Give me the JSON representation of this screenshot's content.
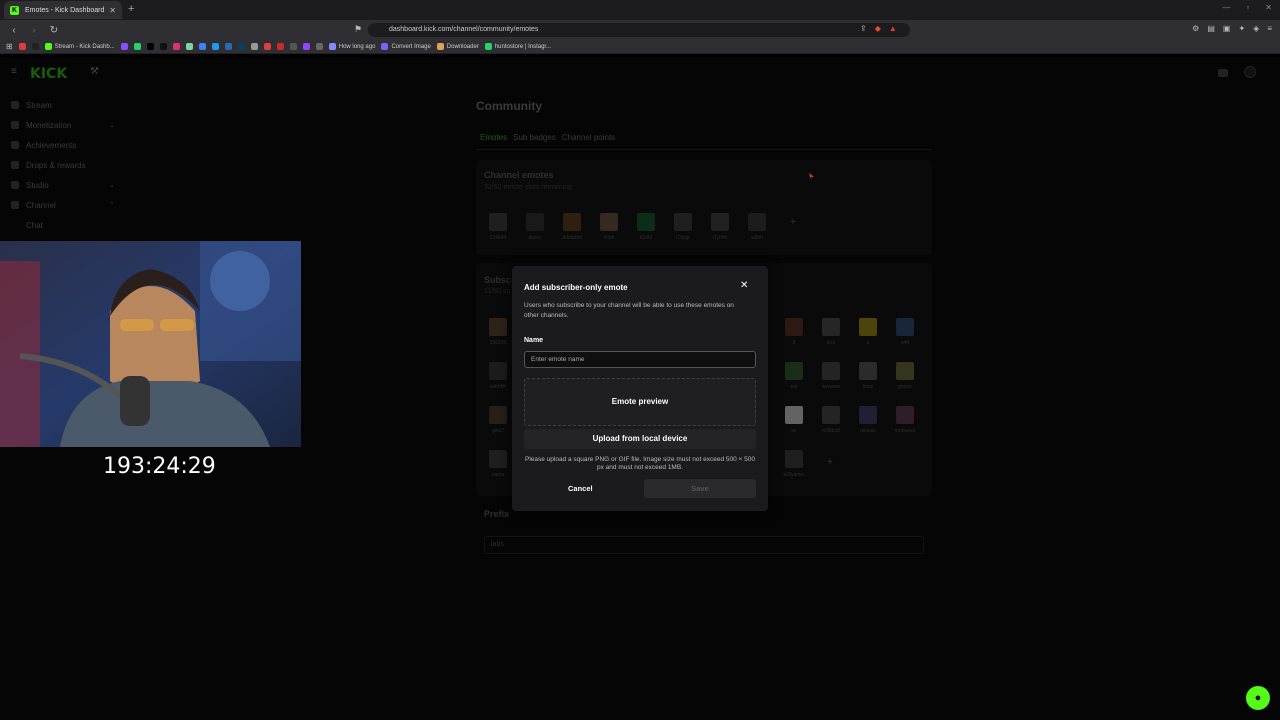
{
  "browser": {
    "tab_title": "Emotes - Kick Dashboard",
    "url": "dashboard.kick.com/channel/community/emotes",
    "bookmarks": [
      {
        "label": "",
        "color": "#e23c3c"
      },
      {
        "label": "",
        "color": "#222222"
      },
      {
        "label": "Stream - Kick Dashb...",
        "color": "#53fc18"
      },
      {
        "label": "",
        "color": "#8a4fff"
      },
      {
        "label": "",
        "color": "#25d366"
      },
      {
        "label": "",
        "color": "#000000"
      },
      {
        "label": "",
        "color": "#111111"
      },
      {
        "label": "",
        "color": "#e1306c"
      },
      {
        "label": "",
        "color": "#7fd4a6"
      },
      {
        "label": "",
        "color": "#3b82f6"
      },
      {
        "label": "",
        "color": "#1d9bf0"
      },
      {
        "label": "",
        "color": "#2b6cb0"
      },
      {
        "label": "",
        "color": "#0a3d62"
      },
      {
        "label": "",
        "color": "#999999"
      },
      {
        "label": "",
        "color": "#e23c3c"
      },
      {
        "label": "",
        "color": "#cc2929"
      },
      {
        "label": "",
        "color": "#555555"
      },
      {
        "label": "",
        "color": "#9146ff"
      },
      {
        "label": "",
        "color": "#666666"
      },
      {
        "label": "How long ago",
        "color": "#8888ff"
      },
      {
        "label": "Convert Image",
        "color": "#7b61ff"
      },
      {
        "label": "Downloader",
        "color": "#e0a05a"
      },
      {
        "label": "huntostore | Instagr...",
        "color": "#25d366"
      }
    ]
  },
  "sidebar": {
    "items": [
      {
        "label": "Stream"
      },
      {
        "label": "Monetization",
        "chevron": "⌄"
      },
      {
        "label": "Achievements"
      },
      {
        "label": "Drops & rewards"
      },
      {
        "label": "Studio",
        "chevron": "⌄"
      },
      {
        "label": "Channel",
        "chevron": "⌃"
      }
    ],
    "sub_item": "Chat"
  },
  "overlay": {
    "timer": "193:24:29"
  },
  "community": {
    "title": "Community",
    "tabs": [
      "Emotes",
      "Sub badges",
      "Channel points"
    ],
    "channel_emotes": {
      "title": "Channel emotes",
      "subtitle": "32/60 emote slots remaining",
      "emotes": [
        {
          "name": "224244",
          "color": "#3a3a3a"
        },
        {
          "name": "dance",
          "color": "#2c2c2c"
        },
        {
          "name": "ddddddd",
          "color": "#5a3a1a"
        },
        {
          "name": "hhhh",
          "color": "#6a5040"
        },
        {
          "name": "KSA1",
          "color": "#0f5a2a"
        },
        {
          "name": "t79pgr",
          "color": "#3a3a3a"
        },
        {
          "name": "i7yhhh",
          "color": "#3d3d3d"
        },
        {
          "name": "w8hh",
          "color": "#333333"
        }
      ]
    },
    "sub_emotes": {
      "title": "Subsc",
      "subtitle": "11/60 su",
      "left_emotes": [
        {
          "name": "236235",
          "color": "#5a4030"
        },
        {
          "name": "ashhhh",
          "color": "#333333"
        },
        {
          "name": "gisa7",
          "color": "#4a3a2a"
        },
        {
          "name": "nasra",
          "color": "#3a3a3a"
        }
      ],
      "right_emotes": [
        {
          "name": "8",
          "color": "#5a2a20"
        },
        {
          "name": "ibrd",
          "color": "#4a4a4a"
        },
        {
          "name": "a",
          "color": "#a08a10"
        },
        {
          "name": "a4ff",
          "color": "#2a4a7a"
        },
        {
          "name": "eat",
          "color": "#2a5a2a"
        },
        {
          "name": "wwwww",
          "color": "#444444"
        },
        {
          "name": "floas",
          "color": "#555555"
        },
        {
          "name": "goooo",
          "color": "#6a6a3a"
        },
        {
          "name": "so",
          "color": "#d0d0d0"
        },
        {
          "name": "m38bb8",
          "color": "#444444"
        },
        {
          "name": "mklaas",
          "color": "#3a3a6a"
        },
        {
          "name": "mokaeed",
          "color": "#5a3a4a"
        },
        {
          "name": "w3lyamm",
          "color": "#3a3a3a"
        }
      ]
    },
    "prefix": {
      "title": "Prefix",
      "value": "iabs"
    }
  },
  "modal": {
    "title": "Add subscriber-only emote",
    "description": "Users who subscribe to your channel will be able to use these emotes on other channels.",
    "name_label": "Name",
    "name_placeholder": "Enter emote name",
    "preview_label": "Emote preview",
    "upload_label": "Upload from local device",
    "hint": "Please upload a square PNG or GIF file. Image size must not exceed 500 × 500 px and must not exceed 1MB.",
    "cancel_label": "Cancel",
    "save_label": "Save"
  },
  "colors": {
    "brand_green": "#53fc18"
  }
}
